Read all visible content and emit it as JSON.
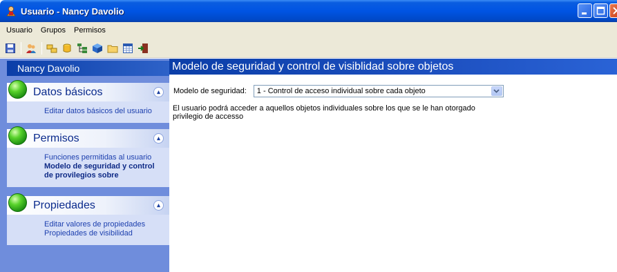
{
  "window": {
    "title": "Usuario - Nancy Davolio",
    "accent": "#0054e3"
  },
  "menubar": {
    "items": [
      "Usuario",
      "Grupos",
      "Permisos"
    ]
  },
  "toolbar": {
    "icons": [
      "save-icon",
      "users-icon",
      "groups-icon",
      "database-icon",
      "tree-icon",
      "cube-icon",
      "folder-icon",
      "grid-icon",
      "exit-icon"
    ]
  },
  "sidebar": {
    "header": "Nancy Davolio",
    "groups": [
      {
        "title": "Datos básicos",
        "links": [
          "Editar datos básicos del usuario"
        ]
      },
      {
        "title": "Permisos",
        "links": [
          "Funciones permitidas al usuario"
        ],
        "active_link": "Modelo de seguridad y control de provilegios sobre"
      },
      {
        "title": "Propiedades",
        "links": [
          "Editar valores de propiedades",
          "Propiedades de visibilidad"
        ]
      }
    ]
  },
  "main": {
    "header": "Modelo de seguridad y control de visiblidad sobre objetos",
    "field_label": "Modelo de seguridad:",
    "select_value": "1 - Control de acceso individual sobre cada objeto",
    "description": "El usuario podrá acceder a aquellos objetos individuales sobre los que se le han otorgado privilegio de accesso"
  }
}
